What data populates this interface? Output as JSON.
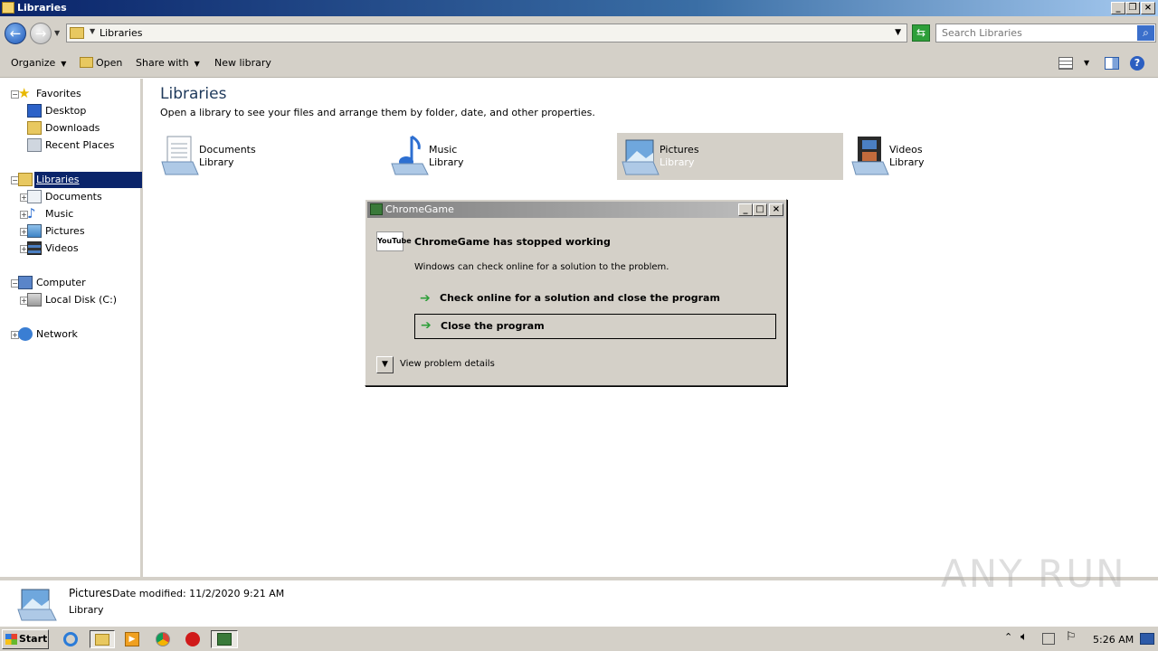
{
  "window": {
    "title": "Libraries"
  },
  "address": {
    "path": "Libraries",
    "search_placeholder": "Search Libraries"
  },
  "toolbar": {
    "organize": "Organize",
    "open": "Open",
    "share_with": "Share with",
    "new_library": "New library"
  },
  "nav": {
    "favorites": "Favorites",
    "favorites_items": [
      "Desktop",
      "Downloads",
      "Recent Places"
    ],
    "libraries": "Libraries",
    "libraries_items": [
      "Documents",
      "Music",
      "Pictures",
      "Videos"
    ],
    "computer": "Computer",
    "computer_items": [
      "Local Disk (C:)"
    ],
    "network": "Network"
  },
  "content": {
    "title": "Libraries",
    "subtitle": "Open a library to see your files and arrange them by folder, date, and other properties.",
    "libraries": [
      {
        "name": "Documents",
        "type": "Library"
      },
      {
        "name": "Music",
        "type": "Library"
      },
      {
        "name": "Pictures",
        "type": "Library"
      },
      {
        "name": "Videos",
        "type": "Library"
      }
    ]
  },
  "dialog": {
    "title": "ChromeGame",
    "app_icon_text": "YouTube",
    "heading": "ChromeGame has stopped working",
    "message": "Windows can check online for a solution to the problem.",
    "option_check": "Check online for a solution and close the program",
    "option_close": "Close the program",
    "details_toggle": "View problem details"
  },
  "details_pane": {
    "name": "Pictures",
    "modified": "Date modified: 11/2/2020 9:21 AM",
    "type": "Library"
  },
  "watermark": "ANY RUN",
  "taskbar": {
    "start": "Start",
    "clock": "5:26 AM"
  },
  "colors": {
    "selection": "#0a246a",
    "dialog_bg": "#d4d0c8",
    "green_arrow": "#2e9f3a"
  }
}
